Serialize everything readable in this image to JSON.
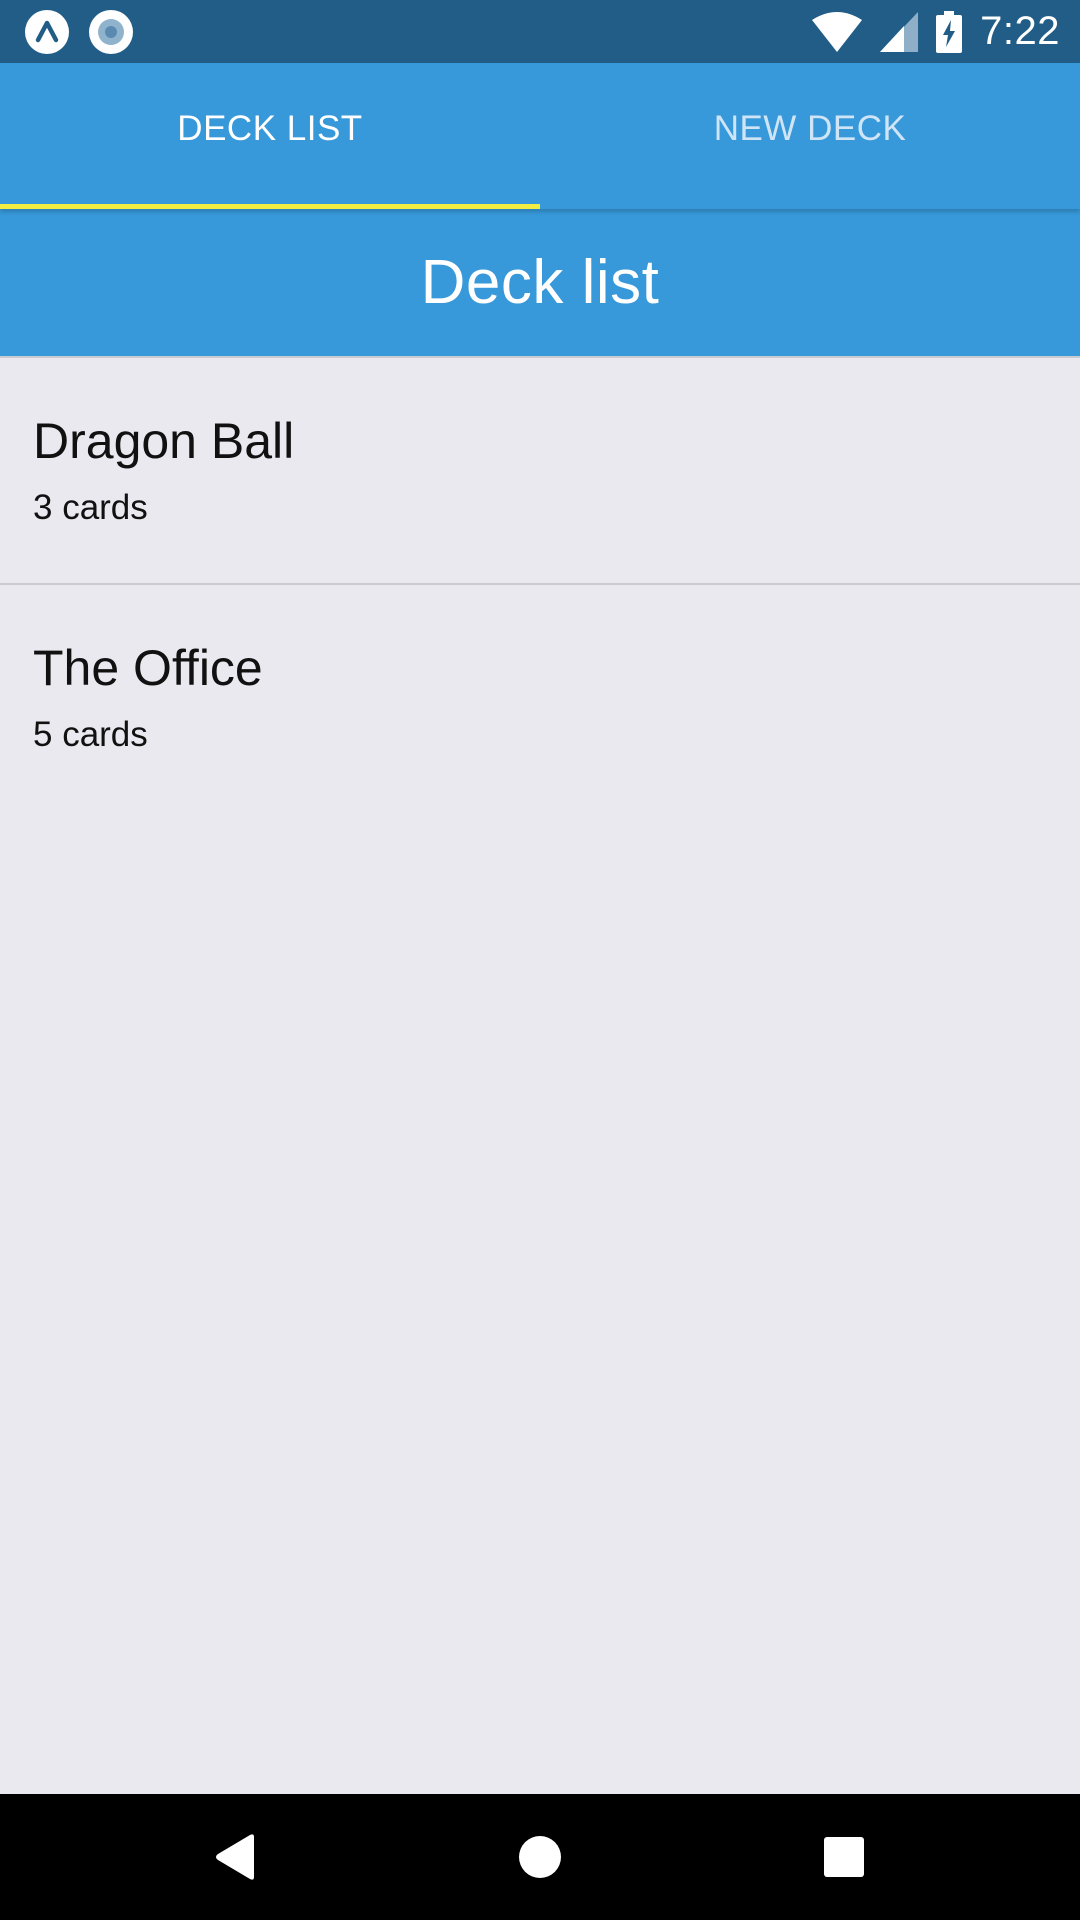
{
  "status_bar": {
    "time": "7:22",
    "left_icons": [
      "expo-icon",
      "record-icon"
    ],
    "right_icons": [
      "wifi-icon",
      "cell-signal-icon",
      "battery-charging-icon"
    ]
  },
  "tabs": [
    {
      "label": "DECK LIST",
      "active": true
    },
    {
      "label": "NEW DECK",
      "active": false
    }
  ],
  "header": {
    "title": "Deck list"
  },
  "decks": [
    {
      "name": "Dragon Ball",
      "count": "3 cards"
    },
    {
      "name": "The Office",
      "count": "5 cards"
    }
  ],
  "nav_bar": {
    "buttons": [
      "back-icon",
      "home-icon",
      "recents-icon"
    ]
  },
  "colors": {
    "status_bar": "#215D86",
    "primary": "#3799DA",
    "tab_indicator": "#F1EE41",
    "background": "#EAE9EF",
    "nav_bar": "#000000"
  }
}
